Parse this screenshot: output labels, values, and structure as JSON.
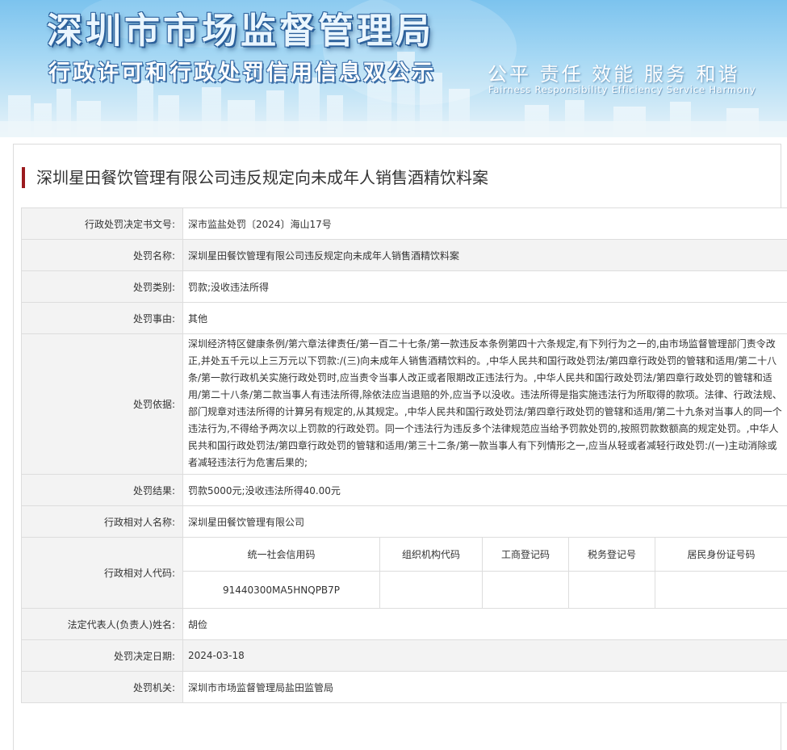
{
  "banner": {
    "title": "深圳市市场监督管理局",
    "subtitle": "行政许可和行政处罚信用信息双公示",
    "slogan_cn": "公平 责任 效能 服务 和谐",
    "slogan_en": "Fairness Responsibility Efficiency Service Harmony"
  },
  "case_title": "深圳星田餐饮管理有限公司违反规定向未成年人销售酒精饮料案",
  "rows": {
    "decision_no": {
      "label": "行政处罚决定书文号:",
      "value": "深市监盐处罚〔2024〕海山17号"
    },
    "penalty_name": {
      "label": "处罚名称:",
      "value": "深圳星田餐饮管理有限公司违反规定向未成年人销售酒精饮料案"
    },
    "penalty_type": {
      "label": "处罚类别:",
      "value": "罚款;没收违法所得"
    },
    "penalty_reason": {
      "label": "处罚事由:",
      "value": "其他"
    },
    "penalty_basis": {
      "label": "处罚依据:",
      "value": "深圳经济特区健康条例/第六章法律责任/第一百二十七条/第一款违反本条例第四十六条规定,有下列行为之一的,由市场监督管理部门责令改正,并处五千元以上三万元以下罚款:/(三)向未成年人销售酒精饮料的。,中华人民共和国行政处罚法/第四章行政处罚的管辖和适用/第二十八条/第一款行政机关实施行政处罚时,应当责令当事人改正或者限期改正违法行为。,中华人民共和国行政处罚法/第四章行政处罚的管辖和适用/第二十八条/第二款当事人有违法所得,除依法应当退赔的外,应当予以没收。违法所得是指实施违法行为所取得的款项。法律、行政法规、部门规章对违法所得的计算另有规定的,从其规定。,中华人民共和国行政处罚法/第四章行政处罚的管辖和适用/第二十九条对当事人的同一个违法行为,不得给予两次以上罚款的行政处罚。同一个违法行为违反多个法律规范应当给予罚款处罚的,按照罚款数额高的规定处罚。,中华人民共和国行政处罚法/第四章行政处罚的管辖和适用/第三十二条/第一款当事人有下列情形之一,应当从轻或者减轻行政处罚:/(一)主动消除或者减轻违法行为危害后果的;"
    },
    "penalty_result": {
      "label": "处罚结果:",
      "value": "罚款5000元;没收违法所得40.00元"
    },
    "party_name": {
      "label": "行政相对人名称:",
      "value": "深圳星田餐饮管理有限公司"
    },
    "party_code": {
      "label": "行政相对人代码:",
      "headers": [
        "统一社会信用码",
        "组织机构代码",
        "工商登记码",
        "税务登记号",
        "居民身份证号码"
      ],
      "values": [
        "91440300MA5HNQPB7P",
        "",
        "",
        "",
        ""
      ]
    },
    "legal_rep": {
      "label": "法定代表人(负责人)姓名:",
      "value": "胡俭"
    },
    "decision_date": {
      "label": "处罚决定日期:",
      "value": "2024-03-18"
    },
    "authority": {
      "label": "处罚机关:",
      "value": "深圳市市场监督管理局盐田监管局"
    }
  },
  "colors": {
    "accent_bar": "#9b1b1e",
    "label_bg": "#f3f3f3",
    "border": "#dddddd",
    "banner_sky": "#7cc3ee"
  }
}
